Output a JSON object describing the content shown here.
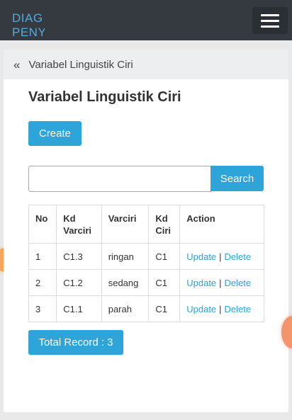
{
  "navbar": {
    "brand": "DIAG\nPENY"
  },
  "breadcrumb": {
    "label": "Variabel Linguistik Ciri"
  },
  "page": {
    "title": "Variabel Linguistik Ciri"
  },
  "buttons": {
    "create": "Create",
    "search": "Search"
  },
  "search": {
    "value": "",
    "placeholder": ""
  },
  "table": {
    "headers": [
      "No",
      "Kd\nVarciri",
      "Varciri",
      "Kd\nCiri",
      "Action"
    ],
    "rows": [
      {
        "no": "1",
        "kd_varciri": "C1.3",
        "varciri": "ringan",
        "kd_ciri": "C1",
        "update": "Update",
        "delete": "Delete"
      },
      {
        "no": "2",
        "kd_varciri": "C1.2",
        "varciri": "sedang",
        "kd_ciri": "C1",
        "update": "Update",
        "delete": "Delete"
      },
      {
        "no": "3",
        "kd_varciri": "C1.1",
        "varciri": "parah",
        "kd_ciri": "C1",
        "update": "Update",
        "delete": "Delete"
      }
    ],
    "action_separator": "|"
  },
  "total": {
    "label": "Total Record : 3"
  },
  "colors": {
    "primary": "#2ea4d8",
    "navbar": "#343a40",
    "brand": "#5aa9d6"
  }
}
